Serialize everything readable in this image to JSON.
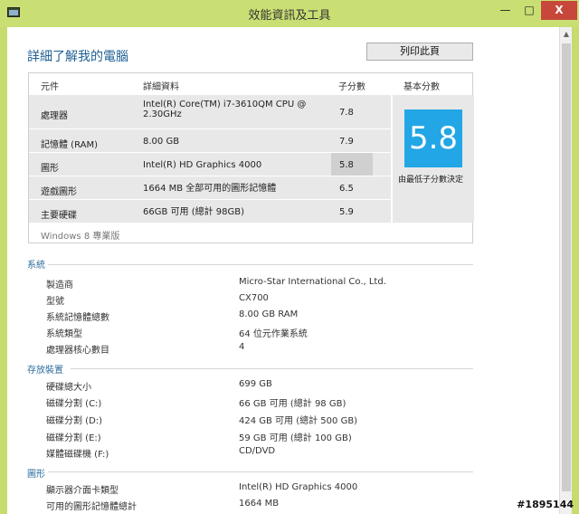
{
  "window": {
    "title": "效能資訊及工具",
    "min_label": "—",
    "max_label": "□",
    "close_label": "X"
  },
  "page": {
    "heading": "詳細了解我的電腦",
    "print_label": "列印此頁"
  },
  "scores": {
    "headers": [
      "元件",
      "詳細資料",
      "子分數",
      "基本分數"
    ],
    "rows": [
      {
        "component": "處理器",
        "detail": "Intel(R) Core(TM) i7-3610QM CPU @ 2.30GHz",
        "subscore": "7.8"
      },
      {
        "component": "記憶體 (RAM)",
        "detail": "8.00 GB",
        "subscore": "7.9"
      },
      {
        "component": "圖形",
        "detail": "Intel(R) HD Graphics 4000",
        "subscore": "5.8"
      },
      {
        "component": "遊戲圖形",
        "detail": "1664 MB 全部可用的圖形記憶體",
        "subscore": "6.5"
      },
      {
        "component": "主要硬碟",
        "detail": "66GB 可用 (總計 98GB)",
        "subscore": "5.9"
      }
    ],
    "base_score": "5.8",
    "base_note": "由最低子分數決定",
    "edition": "Windows 8 專業版"
  },
  "system": {
    "title": "系統",
    "items": [
      {
        "label": "製造商",
        "value": "Micro-Star International Co., Ltd."
      },
      {
        "label": "型號",
        "value": "CX700"
      },
      {
        "label": "系統記憶體總數",
        "value": "8.00 GB RAM"
      },
      {
        "label": "系統類型",
        "value": "64 位元作業系統"
      },
      {
        "label": "處理器核心數目",
        "value": "4"
      }
    ]
  },
  "storage": {
    "title": "存放裝置",
    "items": [
      {
        "label": "硬碟總大小",
        "value": "699 GB"
      },
      {
        "label": "磁碟分割 (C:)",
        "value": "66 GB 可用 (總計 98 GB)"
      },
      {
        "label": "磁碟分割 (D:)",
        "value": "424 GB 可用 (總計 500 GB)"
      },
      {
        "label": "磁碟分割 (E:)",
        "value": "59 GB 可用 (總計 100 GB)"
      },
      {
        "label": "媒體磁碟機 (F:)",
        "value": "CD/DVD"
      }
    ]
  },
  "graphics": {
    "title": "圖形",
    "items": [
      {
        "label": "顯示器介面卡類型",
        "value": "Intel(R) HD Graphics 4000"
      },
      {
        "label": "可用的圖形記憶體總計",
        "value": "1664 MB"
      }
    ]
  },
  "watermark": "#1895144"
}
